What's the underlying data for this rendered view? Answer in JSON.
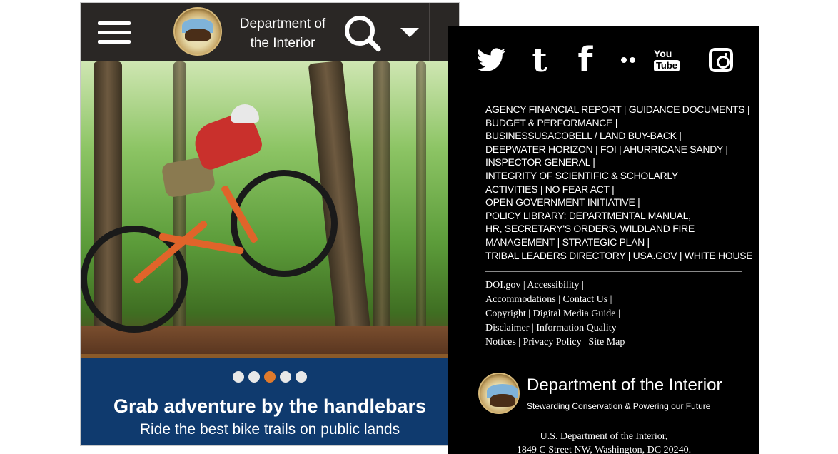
{
  "left": {
    "header": {
      "org_line1": "Department of",
      "org_line2": "the Interior",
      "icons": [
        "hamburger-menu-icon",
        "doi-seal-logo",
        "search-icon",
        "chevron-down-icon"
      ]
    },
    "carousel": {
      "slide_count": 5,
      "active_index": 2,
      "title": "Grab adventure by the handlebars",
      "subtitle": "Ride the best bike trails on public lands",
      "colors": {
        "caption_bg": "#0f3a6e",
        "active_dot": "#e07a2c",
        "inactive_dot": "#e8e8e8"
      }
    }
  },
  "right": {
    "social": [
      "twitter-icon",
      "tumblr-icon",
      "facebook-icon",
      "flickr-icon",
      "youtube-icon",
      "instagram-icon"
    ],
    "social_glyphs": {
      "tumblr": "t",
      "facebook": "f",
      "youtube_top": "You",
      "youtube_bottom": "Tube"
    },
    "links_block1": [
      "AGENCY FINANCIAL REPORT | GUIDANCE DOCUMENTS |",
      "BUDGET & PERFORMANCE |",
      "BUSINESSUSACOBELL / LAND BUY-BACK |",
      "DEEPWATER HORIZON | FOI | AHURRICANE SANDY |",
      "INSPECTOR GENERAL |",
      "INTEGRITY OF SCIENTIFIC & SCHOLARLY",
      "ACTIVITIES | NO FEAR ACT |",
      "OPEN GOVERNMENT INITIATIVE |",
      "POLICY LIBRARY: DEPARTMENTAL MANUAL,",
      "HR, SECRETARY'S ORDERS, WILDLAND FIRE",
      "MANAGEMENT | STRATEGIC PLAN |",
      "TRIBAL LEADERS DIRECTORY | USA.GOV | WHITE HOUSE"
    ],
    "links_block2": [
      "DOI.gov | Accessibility |",
      "Accommodations | Contact Us |",
      "Copyright | Digital Media Guide |",
      "Disclaimer | Information Quality |",
      "Notices | Privacy Policy | Site Map"
    ],
    "brand": {
      "name": "Department of the Interior",
      "tagline": "Stewarding Conservation & Powering our Future"
    },
    "address": {
      "line1": "U.S. Department of the Interior,",
      "line2": "1849 C Street NW, Washington, DC 20240."
    }
  }
}
